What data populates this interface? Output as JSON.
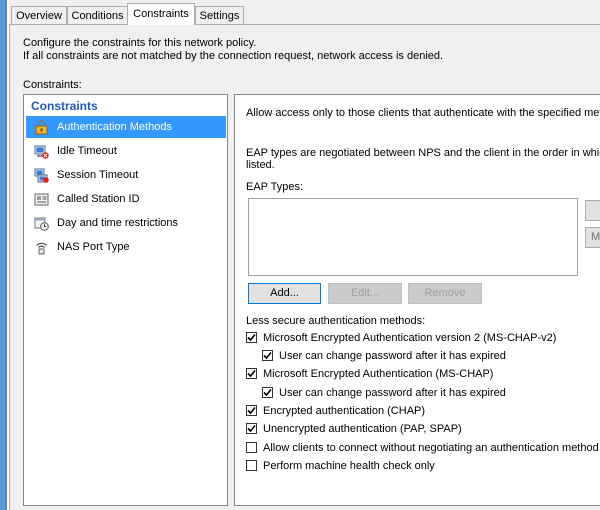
{
  "tabs": [
    {
      "label": "Overview",
      "active": false
    },
    {
      "label": "Conditions",
      "active": false
    },
    {
      "label": "Constraints",
      "active": true
    },
    {
      "label": "Settings",
      "active": false
    }
  ],
  "description": {
    "line1": "Configure the constraints for this network policy.",
    "line2": "If all constraints are not matched by the connection request, network access is denied."
  },
  "constraints_label": "Constraints:",
  "list": {
    "header": "Constraints",
    "items": [
      {
        "label": "Authentication Methods",
        "icon": "lock-icon",
        "selected": true
      },
      {
        "label": "Idle Timeout",
        "icon": "idle-timeout-icon",
        "selected": false
      },
      {
        "label": "Session Timeout",
        "icon": "session-timeout-icon",
        "selected": false
      },
      {
        "label": "Called Station ID",
        "icon": "station-id-icon",
        "selected": false
      },
      {
        "label": "Day and time restrictions",
        "icon": "clock-icon",
        "selected": false
      },
      {
        "label": "NAS Port Type",
        "icon": "port-type-icon",
        "selected": false
      }
    ]
  },
  "pane": {
    "intro": "Allow access only to those clients that authenticate with the specified metho",
    "eap_note1": "EAP types are negotiated between NPS and the client in the order in which",
    "eap_note2": "listed.",
    "eap_types_label": "EAP Types:",
    "side_button_up": "",
    "side_button_down": "M",
    "buttons": {
      "add": "Add...",
      "edit": "Edit...",
      "remove": "Remove"
    },
    "less_secure_label": "Less secure authentication methods:",
    "options": [
      {
        "label": "Microsoft Encrypted Authentication version 2 (MS-CHAP-v2)",
        "checked": true,
        "indent": false
      },
      {
        "label": "User can change password after it has expired",
        "checked": true,
        "indent": true
      },
      {
        "label": "Microsoft Encrypted Authentication (MS-CHAP)",
        "checked": true,
        "indent": false
      },
      {
        "label": "User can change password after it has expired",
        "checked": true,
        "indent": true
      },
      {
        "label": "Encrypted authentication (CHAP)",
        "checked": true,
        "indent": false
      },
      {
        "label": "Unencrypted authentication (PAP, SPAP)",
        "checked": true,
        "indent": false
      },
      {
        "label": "Allow clients to connect without negotiating an authentication method",
        "checked": false,
        "indent": false
      },
      {
        "label": "Perform machine health check only",
        "checked": false,
        "indent": false
      }
    ]
  },
  "colors": {
    "accent": "#3399ff",
    "header": "#1f5ab5",
    "window_border": "#5b9bd5"
  }
}
